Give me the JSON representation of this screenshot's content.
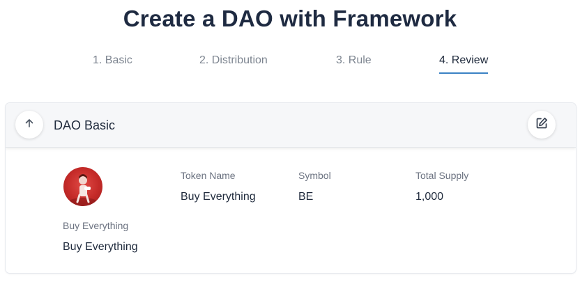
{
  "page": {
    "title": "Create a DAO with Framework"
  },
  "steps": [
    {
      "label": "1. Basic"
    },
    {
      "label": "2. Distribution"
    },
    {
      "label": "3. Rule"
    },
    {
      "label": "4. Review"
    }
  ],
  "active_step": "4. Review",
  "card": {
    "title": "DAO Basic",
    "collapse_icon": "arrow-up-icon",
    "edit_icon": "edit-icon",
    "avatar_label": "Buy Everything",
    "avatar_value": "Buy Everything",
    "fields": {
      "token_name": {
        "label": "Token Name",
        "value": "Buy Everything"
      },
      "symbol": {
        "label": "Symbol",
        "value": "BE"
      },
      "total_supply": {
        "label": "Total Supply",
        "value": "1,000"
      }
    }
  },
  "colors": {
    "accent": "#3b82c4",
    "title": "#1e2a41",
    "muted": "#7d8590"
  }
}
